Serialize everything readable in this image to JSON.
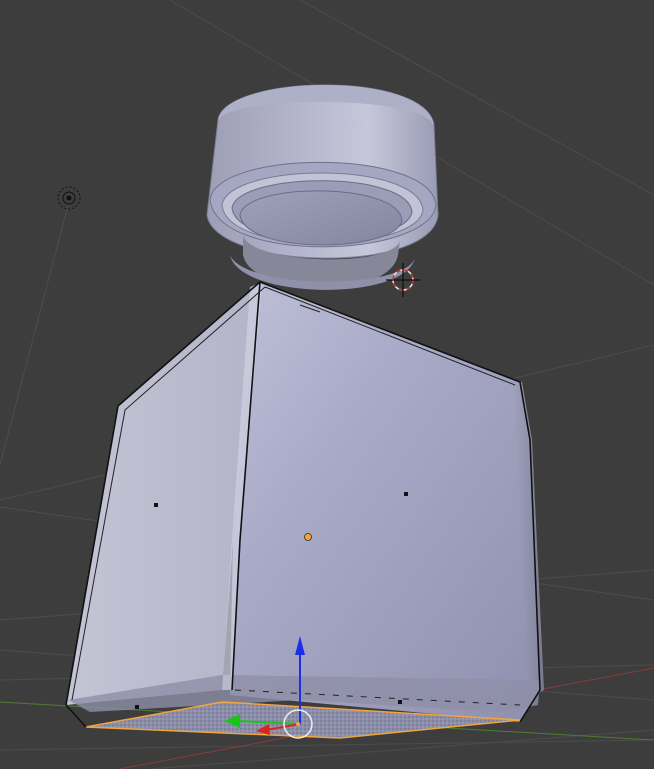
{
  "viewport": {
    "background_color": "#3d3d3d",
    "grid_color": "#494949",
    "x_axis_color": "#8a3b3b",
    "y_axis_color": "#4f7a33"
  },
  "objects": {
    "bottle_body": {
      "selected": true,
      "edit_mode_face_selected": true,
      "base_color": "#a8a9c6"
    },
    "bottle_cap": {
      "selected": false,
      "base_color": "#9c9db9"
    },
    "lamp": {
      "icon": "lamp-icon"
    },
    "cursor_3d": {
      "icon": "3d-cursor-icon"
    }
  },
  "manipulator": {
    "x_axis_color": "#d8261f",
    "y_axis_color": "#1bc41b",
    "z_axis_color": "#1b2ee8",
    "selection_color": "#f3a53c"
  }
}
